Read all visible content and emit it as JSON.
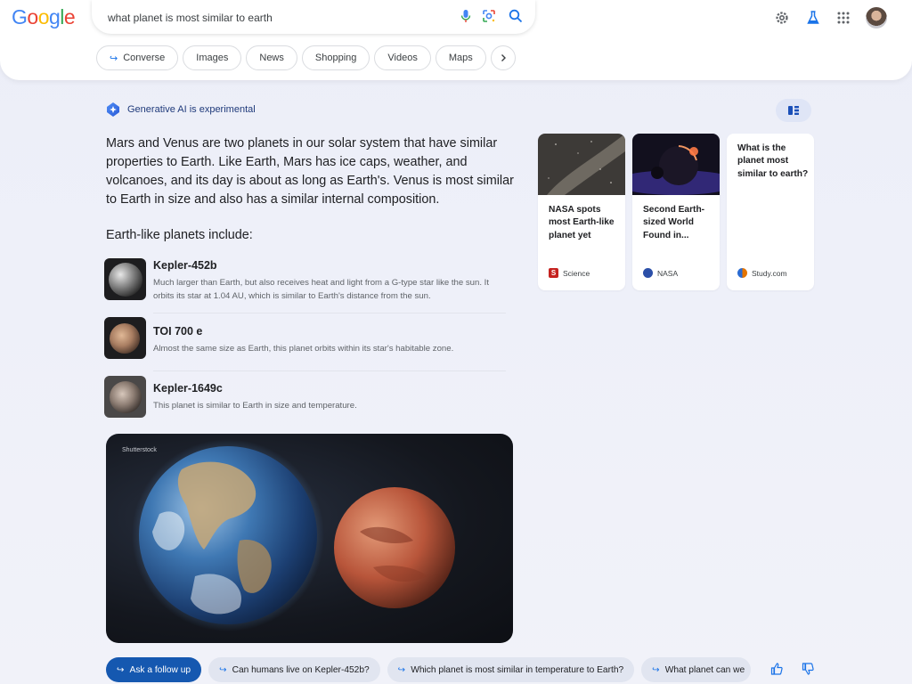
{
  "header": {
    "logo_letters": [
      {
        "ch": "G",
        "color": "#4285F4"
      },
      {
        "ch": "o",
        "color": "#EA4335"
      },
      {
        "ch": "o",
        "color": "#FBBC05"
      },
      {
        "ch": "g",
        "color": "#4285F4"
      },
      {
        "ch": "l",
        "color": "#34A853"
      },
      {
        "ch": "e",
        "color": "#EA4335"
      }
    ],
    "search_query": "what planet is most similar to earth",
    "icons": [
      "mic-icon",
      "lens-icon",
      "search-icon",
      "settings-icon",
      "labs-icon",
      "apps-icon"
    ]
  },
  "tabs": [
    {
      "label": "Converse",
      "icon": "arrow-icon"
    },
    {
      "label": "Images"
    },
    {
      "label": "News"
    },
    {
      "label": "Shopping"
    },
    {
      "label": "Videos"
    },
    {
      "label": "Maps"
    }
  ],
  "ai": {
    "badge_label": "Generative AI is experimental",
    "summary": "Mars and Venus are two planets in our solar system that have similar properties to Earth. Like Earth, Mars has ice caps, weather, and volcanoes, and its day is about as long as Earth's. Venus is most similar to Earth in size and also has a similar internal composition.",
    "subheading": "Earth-like planets include:",
    "planets": [
      {
        "name": "Kepler-452b",
        "description": "Much larger than Earth, but also receives heat and light from a G-type star like the sun. It orbits its star at 1.04 AU, which is similar to Earth's distance from the sun."
      },
      {
        "name": "TOI 700 e",
        "description": "Almost the same size as Earth, this planet orbits within its star's habitable zone."
      },
      {
        "name": "Kepler-1649c",
        "description": "This planet is similar to Earth in size and temperature."
      }
    ],
    "hero_credit": "Shutterstock"
  },
  "sources": [
    {
      "title": "NASA spots most Earth-like planet yet",
      "site": "Science",
      "site_color": "#c5221f"
    },
    {
      "title": "Second Earth-sized World Found in...",
      "site": "NASA",
      "site_color": "#2b4fa8"
    },
    {
      "title": "What is the planet most similar to earth?",
      "site": "Study.com",
      "site_color": "#e37400"
    }
  ],
  "followups": [
    {
      "label": "Ask a follow up",
      "primary": true
    },
    {
      "label": "Can humans live on Kepler-452b?"
    },
    {
      "label": "Which planet is most similar in temperature to Earth?"
    },
    {
      "label": "What planet can we"
    }
  ],
  "feedback": [
    "thumbs-up-icon",
    "thumbs-down-icon"
  ]
}
